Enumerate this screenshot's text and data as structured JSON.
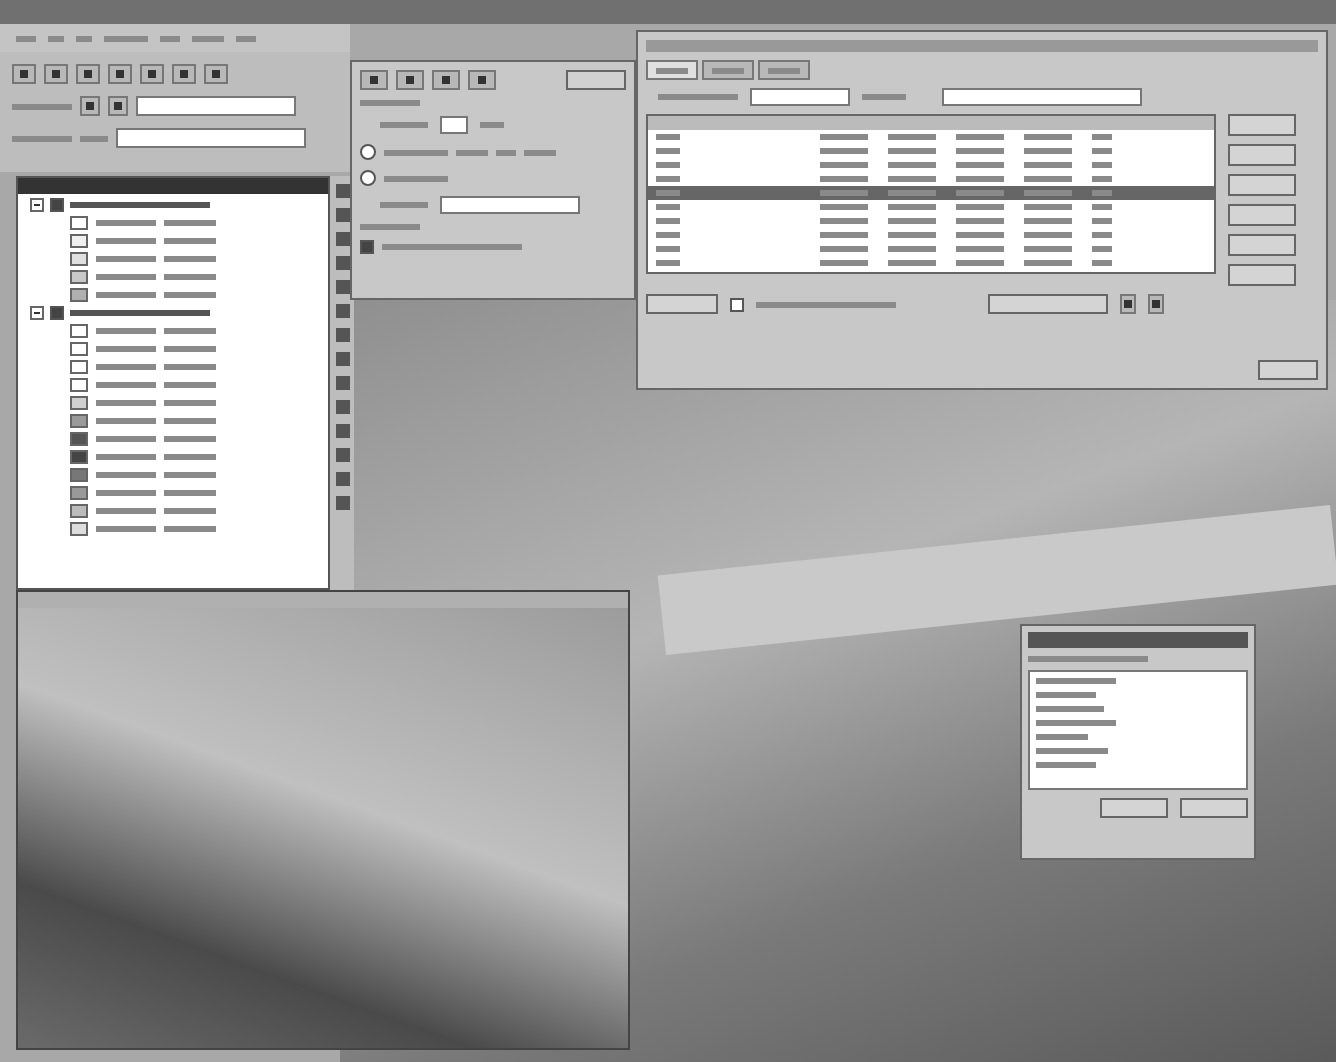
{
  "layer_tree": {
    "groups": [
      {
        "expanded": true,
        "checked": true,
        "items": [
          {
            "color": "#ffffff"
          },
          {
            "color": "#f0f0f0"
          },
          {
            "color": "#e0e0e0"
          },
          {
            "color": "#c8c8c8"
          },
          {
            "color": "#b0b0b0"
          }
        ]
      },
      {
        "expanded": true,
        "checked": true,
        "items": [
          {
            "color": "#ffffff"
          },
          {
            "color": "#ffffff"
          },
          {
            "color": "#ffffff"
          },
          {
            "color": "#ffffff"
          },
          {
            "color": "#d0d0d0"
          },
          {
            "color": "#9a9a9a"
          },
          {
            "color": "#555555"
          },
          {
            "color": "#444444"
          },
          {
            "color": "#777777"
          },
          {
            "color": "#999999"
          },
          {
            "color": "#bbbbbb"
          },
          {
            "color": "#dddddd"
          }
        ]
      }
    ]
  },
  "options_dialog": {
    "radios": [
      {
        "selected": false
      },
      {
        "selected": false
      }
    ],
    "checkbox": {
      "checked": true
    }
  },
  "attribute_table": {
    "tabs": [
      {
        "selected": true
      },
      {
        "selected": false
      },
      {
        "selected": false
      }
    ],
    "rows": [
      {
        "selected": false
      },
      {
        "selected": false
      },
      {
        "selected": false
      },
      {
        "selected": false
      },
      {
        "selected": true
      },
      {
        "selected": false
      },
      {
        "selected": false
      },
      {
        "selected": false
      },
      {
        "selected": false
      },
      {
        "selected": false
      }
    ],
    "checkbox": {
      "checked": false
    }
  }
}
